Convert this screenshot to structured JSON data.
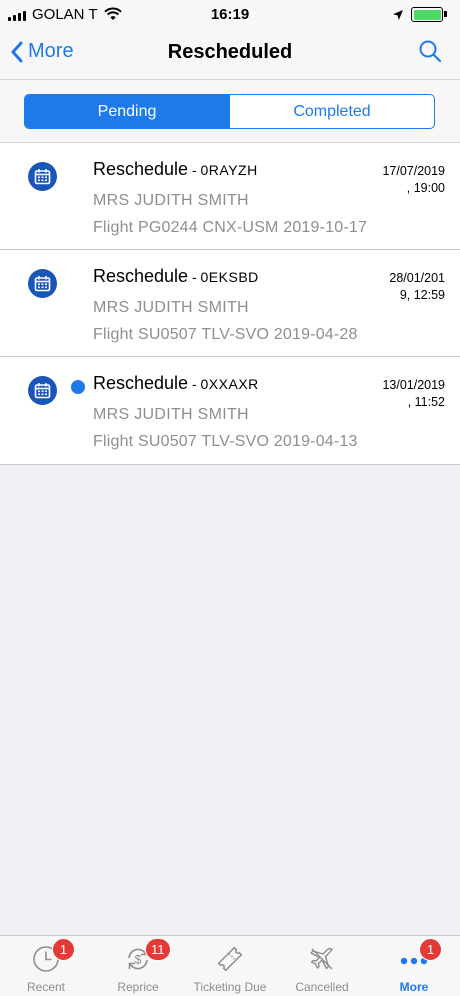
{
  "status_bar": {
    "carrier": "GOLAN T",
    "time": "16:19"
  },
  "nav": {
    "back_label": "More",
    "title": "Rescheduled"
  },
  "segments": {
    "pending": "Pending",
    "completed": "Completed"
  },
  "rows": [
    {
      "title": "Reschedule",
      "dash": " - ",
      "code": "0RAYZH",
      "name": "MRS JUDITH SMITH",
      "flight": "Flight PG0244 CNX-USM 2019-10-17",
      "date_line1": "17/07/2019",
      "date_line2": ", 19:00",
      "unread": false
    },
    {
      "title": "Reschedule",
      "dash": " - ",
      "code": "0EKSBD",
      "name": "MRS JUDITH SMITH",
      "flight": "Flight SU0507 TLV-SVO 2019-04-28",
      "date_line1": "28/01/201",
      "date_line2": "9, 12:59",
      "unread": false
    },
    {
      "title": "Reschedule",
      "dash": " - ",
      "code": "0XXAXR",
      "name": "MRS JUDITH SMITH",
      "flight": "Flight SU0507 TLV-SVO 2019-04-13",
      "date_line1": "13/01/2019",
      "date_line2": ", 11:52",
      "unread": true
    }
  ],
  "tabs": [
    {
      "label": "Recent",
      "icon": "clock-icon",
      "badge": "1"
    },
    {
      "label": "Reprice",
      "icon": "reprice-icon",
      "badge": "11"
    },
    {
      "label": "Ticketing Due",
      "icon": "ticket-icon",
      "badge": ""
    },
    {
      "label": "Cancelled",
      "icon": "plane-cancelled-icon",
      "badge": ""
    },
    {
      "label": "More",
      "icon": "more-dots-icon",
      "badge": "1"
    }
  ],
  "colors": {
    "accent": "#1e7ae8",
    "badge": "#e53935",
    "row_icon": "#1a56b8",
    "battery": "#4cd964"
  }
}
